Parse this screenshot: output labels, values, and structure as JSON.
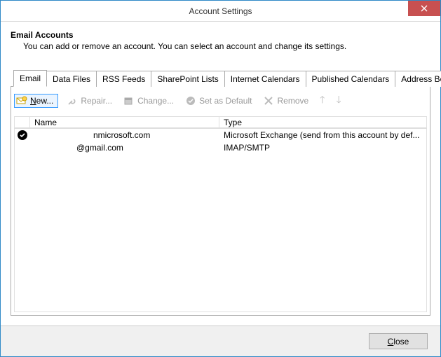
{
  "window": {
    "title": "Account Settings"
  },
  "header": {
    "heading": "Email Accounts",
    "subheading": "You can add or remove an account. You can select an account and change its settings."
  },
  "tabs": [
    {
      "label": "Email",
      "active": true
    },
    {
      "label": "Data Files",
      "active": false
    },
    {
      "label": "RSS Feeds",
      "active": false
    },
    {
      "label": "SharePoint Lists",
      "active": false
    },
    {
      "label": "Internet Calendars",
      "active": false
    },
    {
      "label": "Published Calendars",
      "active": false
    },
    {
      "label": "Address Books",
      "active": false
    }
  ],
  "toolbar": {
    "new_label": "New...",
    "repair_label": "Repair...",
    "change_label": "Change...",
    "default_label": "Set as Default",
    "remove_label": "Remove"
  },
  "columns": {
    "name": "Name",
    "type": "Type"
  },
  "accounts": [
    {
      "default": true,
      "name_suffix": "nmicrosoft.com",
      "type": "Microsoft Exchange (send from this account by def..."
    },
    {
      "default": false,
      "name_suffix": "@gmail.com",
      "type": "IMAP/SMTP"
    }
  ],
  "footer": {
    "close_label": "Close"
  }
}
